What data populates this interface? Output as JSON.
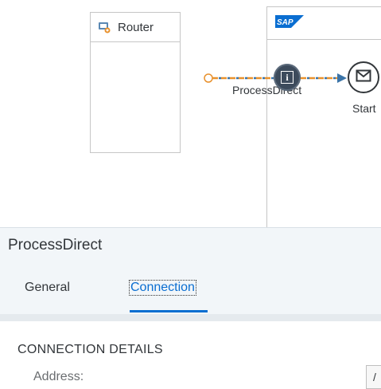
{
  "canvas": {
    "router": {
      "label": "Router",
      "icon": "router-icon"
    },
    "sap_participant": {
      "logo_text": "SAP",
      "logo_color": "#0a6ed1"
    },
    "connection": {
      "label": "ProcessDirect",
      "icon": "info-icon",
      "line_color": "#e8912d",
      "dash_color": "#3b74a8"
    },
    "start_event": {
      "label": "Start",
      "icon": "envelope-icon"
    }
  },
  "properties": {
    "title": "ProcessDirect",
    "tabs": [
      {
        "label": "General",
        "active": false
      },
      {
        "label": "Connection",
        "active": true
      }
    ],
    "section_title": "CONNECTION DETAILS",
    "fields": [
      {
        "label": "Address:",
        "value": "/"
      }
    ],
    "accent_color": "#0a6ed1"
  }
}
